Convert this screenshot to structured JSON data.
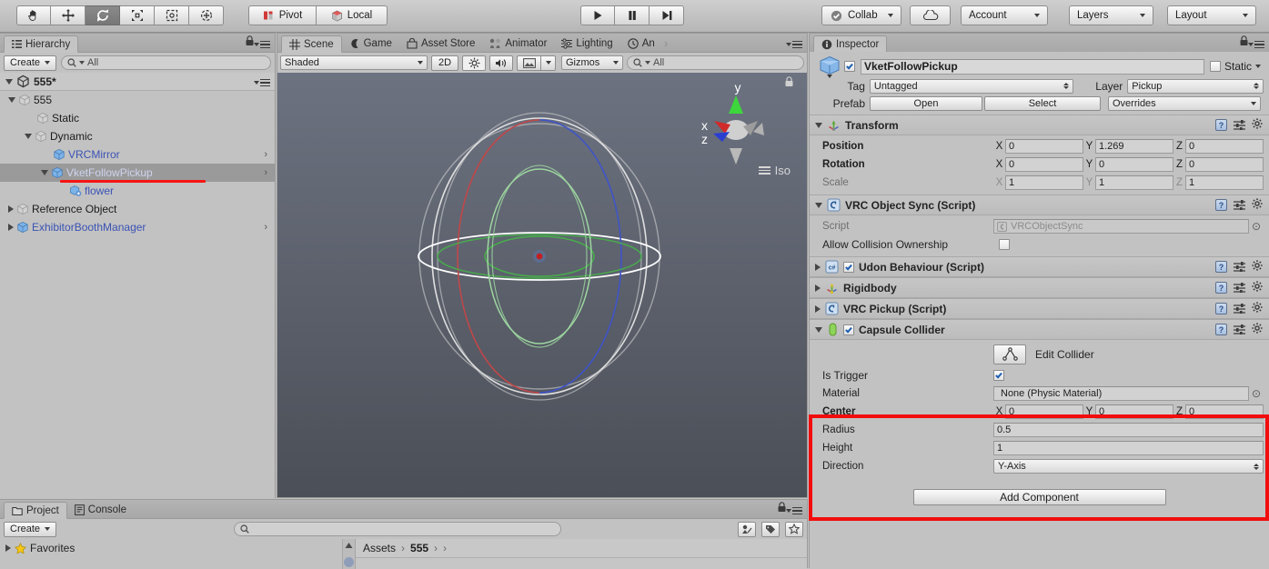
{
  "toolbar": {
    "tools": [
      {
        "name": "hand-tool",
        "glyph": "hand",
        "active": false
      },
      {
        "name": "move-tool",
        "glyph": "move",
        "active": false
      },
      {
        "name": "rotate-tool",
        "glyph": "rotate",
        "active": true
      },
      {
        "name": "scale-tool",
        "glyph": "scale",
        "active": false
      },
      {
        "name": "rect-tool",
        "glyph": "rect",
        "active": false
      },
      {
        "name": "transform-tool",
        "glyph": "transform",
        "active": false
      }
    ],
    "pivot_label": "Pivot",
    "local_label": "Local",
    "play_label": "▶",
    "pause_label": "❙❙",
    "step_label": "▶❙",
    "collab_label": "Collab",
    "cloud_label": "",
    "account_label": "Account",
    "layers_label": "Layers",
    "layout_label": "Layout"
  },
  "hierarchy": {
    "tab_label": "Hierarchy",
    "create_label": "Create",
    "search_placeholder": "All",
    "search_prefix": "Q",
    "scene_name": "555*",
    "items": [
      {
        "label": "555",
        "depth": 1,
        "arrow": "open",
        "icon": "grey-cube",
        "blue": false,
        "selected": false,
        "chevron": false
      },
      {
        "label": "Static",
        "depth": 2,
        "arrow": "none",
        "icon": "grey-cube",
        "blue": false,
        "selected": false,
        "chevron": false
      },
      {
        "label": "Dynamic",
        "depth": 2,
        "arrow": "open",
        "icon": "grey-cube",
        "blue": false,
        "selected": false,
        "chevron": false
      },
      {
        "label": "VRCMirror",
        "depth": 3,
        "arrow": "none",
        "icon": "blue-cube",
        "blue": true,
        "selected": false,
        "chevron": true
      },
      {
        "label": "VketFollowPickup",
        "depth": 3,
        "arrow": "open",
        "icon": "blue-cube",
        "blue": true,
        "selected": true,
        "chevron": true
      },
      {
        "label": "flower",
        "depth": 4,
        "arrow": "none",
        "icon": "prefab-cube",
        "blue": true,
        "selected": false,
        "chevron": false
      },
      {
        "label": "Reference Object",
        "depth": 1,
        "arrow": "closed",
        "icon": "grey-cube",
        "blue": false,
        "selected": false,
        "chevron": false
      },
      {
        "label": "ExhibitorBoothManager",
        "depth": 1,
        "arrow": "closed",
        "icon": "blue-cube",
        "blue": true,
        "selected": false,
        "chevron": true
      }
    ]
  },
  "scene": {
    "tabs": [
      {
        "label": "Scene",
        "icon": "grid-icon",
        "active": true
      },
      {
        "label": "Game",
        "icon": "gamepad-icon",
        "active": false
      },
      {
        "label": "Asset Store",
        "icon": "store-icon",
        "active": false
      },
      {
        "label": "Animator",
        "icon": "animator-icon",
        "active": false
      },
      {
        "label": "Lighting",
        "icon": "lighting-icon",
        "active": false
      },
      {
        "label": "An",
        "icon": "clock-icon",
        "active": false
      }
    ],
    "shading_mode": "Shaded",
    "mode_2d": "2D",
    "gizmos_label": "Gizmos",
    "search_placeholder": "All",
    "search_prefix": "Q",
    "axis_x": "x",
    "axis_y": "y",
    "axis_z": "z",
    "projection_label": "Iso"
  },
  "project": {
    "tabs": [
      {
        "label": "Project",
        "icon": "folder-icon",
        "active": true
      },
      {
        "label": "Console",
        "icon": "console-icon",
        "active": false
      }
    ],
    "create_label": "Create",
    "search_placeholder": "",
    "search_prefix": "Q",
    "favorites_label": "Favorites",
    "breadcrumb": [
      "Assets",
      "555",
      ""
    ]
  },
  "inspector": {
    "tab_label": "Inspector",
    "object_name": "VketFollowPickup",
    "object_enabled": true,
    "static_label": "Static",
    "static_checked": false,
    "tag_label": "Tag",
    "tag_value": "Untagged",
    "layer_label": "Layer",
    "layer_value": "Pickup",
    "prefab_label": "Prefab",
    "prefab_open": "Open",
    "prefab_select": "Select",
    "prefab_overrides": "Overrides",
    "add_component_label": "Add Component",
    "components": [
      {
        "title": "Transform",
        "icon": "transform-icon",
        "expanded": true,
        "has_checkbox": false,
        "rows": [
          {
            "type": "vec3",
            "label": "Position",
            "x": "0",
            "y": "1.269",
            "z": "0",
            "dim": false
          },
          {
            "type": "vec3",
            "label": "Rotation",
            "x": "0",
            "y": "0",
            "z": "0",
            "dim": false
          },
          {
            "type": "vec3",
            "label": "Scale",
            "x": "1",
            "y": "1",
            "z": "1",
            "dim": true
          }
        ]
      },
      {
        "title": "VRC Object Sync (Script)",
        "icon": "script-icon",
        "expanded": true,
        "has_checkbox": false,
        "rows": [
          {
            "type": "object",
            "label": "Script",
            "value": "VRCObjectSync",
            "dim": true
          },
          {
            "type": "checkbox",
            "label": "Allow Collision Ownership",
            "checked": false,
            "inline": true
          }
        ]
      },
      {
        "title": "Udon Behaviour (Script)",
        "icon": "cs-icon",
        "expanded": false,
        "has_checkbox": true,
        "checked": true,
        "rows": []
      },
      {
        "title": "Rigidbody",
        "icon": "rigidbody-icon",
        "expanded": false,
        "has_checkbox": false,
        "rows": []
      },
      {
        "title": "VRC Pickup (Script)",
        "icon": "script-icon",
        "expanded": false,
        "has_checkbox": false,
        "rows": []
      },
      {
        "title": "Capsule Collider",
        "icon": "capsule-icon",
        "expanded": true,
        "has_checkbox": true,
        "checked": true,
        "edit_collider_label": "Edit Collider",
        "rows": [
          {
            "type": "checkbox",
            "label": "Is Trigger",
            "checked": true
          },
          {
            "type": "object",
            "label": "Material",
            "value": "None (Physic Material)",
            "dim": false
          },
          {
            "type": "vec3",
            "label": "Center",
            "x": "0",
            "y": "0",
            "z": "0",
            "dim": false
          },
          {
            "type": "text",
            "label": "Radius",
            "value": "0.5"
          },
          {
            "type": "text",
            "label": "Height",
            "value": "1"
          },
          {
            "type": "popup",
            "label": "Direction",
            "value": "Y-Axis"
          }
        ]
      }
    ]
  },
  "annotations": {
    "highlight_color": "#f20d0d",
    "underline_color": "#f61414"
  }
}
